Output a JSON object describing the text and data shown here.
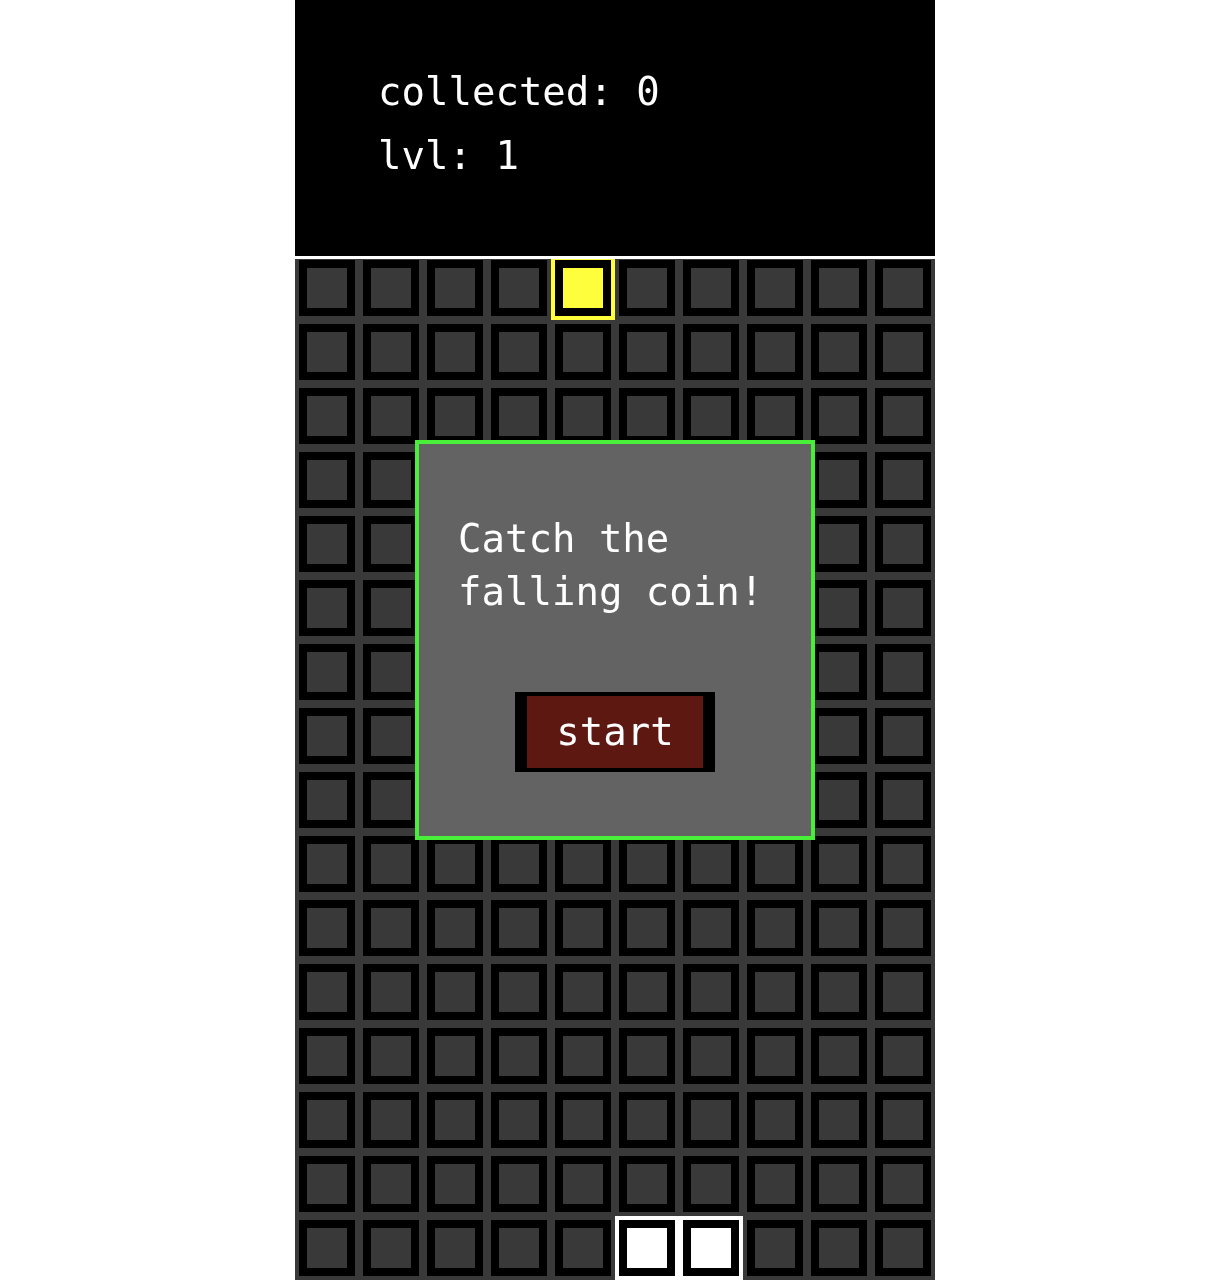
{
  "hud": [
    {
      "label": "collected: 0"
    },
    {
      "label": "lvl: 1"
    }
  ],
  "board": {
    "rows": [
      {
        "cells": [
          {
            "kind": "empty"
          },
          {
            "kind": "empty"
          },
          {
            "kind": "empty"
          },
          {
            "kind": "empty"
          },
          {
            "kind": "coin"
          },
          {
            "kind": "empty"
          },
          {
            "kind": "empty"
          },
          {
            "kind": "empty"
          },
          {
            "kind": "empty"
          },
          {
            "kind": "empty"
          }
        ]
      },
      {
        "cells": [
          {
            "kind": "empty"
          },
          {
            "kind": "empty"
          },
          {
            "kind": "empty"
          },
          {
            "kind": "empty"
          },
          {
            "kind": "empty"
          },
          {
            "kind": "empty"
          },
          {
            "kind": "empty"
          },
          {
            "kind": "empty"
          },
          {
            "kind": "empty"
          },
          {
            "kind": "empty"
          }
        ]
      },
      {
        "cells": [
          {
            "kind": "empty"
          },
          {
            "kind": "empty"
          },
          {
            "kind": "empty"
          },
          {
            "kind": "empty"
          },
          {
            "kind": "empty"
          },
          {
            "kind": "empty"
          },
          {
            "kind": "empty"
          },
          {
            "kind": "empty"
          },
          {
            "kind": "empty"
          },
          {
            "kind": "empty"
          }
        ]
      },
      {
        "cells": [
          {
            "kind": "empty"
          },
          {
            "kind": "empty"
          },
          {
            "kind": "covered"
          },
          {
            "kind": "covered"
          },
          {
            "kind": "covered"
          },
          {
            "kind": "covered"
          },
          {
            "kind": "covered"
          },
          {
            "kind": "covered"
          },
          {
            "kind": "empty"
          },
          {
            "kind": "empty"
          }
        ]
      },
      {
        "cells": [
          {
            "kind": "empty"
          },
          {
            "kind": "empty"
          },
          {
            "kind": "covered"
          },
          {
            "kind": "covered"
          },
          {
            "kind": "covered"
          },
          {
            "kind": "covered"
          },
          {
            "kind": "covered"
          },
          {
            "kind": "covered"
          },
          {
            "kind": "empty"
          },
          {
            "kind": "empty"
          }
        ]
      },
      {
        "cells": [
          {
            "kind": "empty"
          },
          {
            "kind": "empty"
          },
          {
            "kind": "covered"
          },
          {
            "kind": "covered"
          },
          {
            "kind": "covered"
          },
          {
            "kind": "covered"
          },
          {
            "kind": "covered"
          },
          {
            "kind": "covered"
          },
          {
            "kind": "empty"
          },
          {
            "kind": "empty"
          }
        ]
      },
      {
        "cells": [
          {
            "kind": "empty"
          },
          {
            "kind": "empty"
          },
          {
            "kind": "covered"
          },
          {
            "kind": "covered"
          },
          {
            "kind": "covered"
          },
          {
            "kind": "covered"
          },
          {
            "kind": "covered"
          },
          {
            "kind": "covered"
          },
          {
            "kind": "empty"
          },
          {
            "kind": "empty"
          }
        ]
      },
      {
        "cells": [
          {
            "kind": "empty"
          },
          {
            "kind": "empty"
          },
          {
            "kind": "covered"
          },
          {
            "kind": "covered"
          },
          {
            "kind": "covered"
          },
          {
            "kind": "covered"
          },
          {
            "kind": "covered"
          },
          {
            "kind": "covered"
          },
          {
            "kind": "empty"
          },
          {
            "kind": "empty"
          }
        ]
      },
      {
        "cells": [
          {
            "kind": "empty"
          },
          {
            "kind": "empty"
          },
          {
            "kind": "covered"
          },
          {
            "kind": "covered"
          },
          {
            "kind": "covered"
          },
          {
            "kind": "covered"
          },
          {
            "kind": "covered"
          },
          {
            "kind": "covered"
          },
          {
            "kind": "empty"
          },
          {
            "kind": "empty"
          }
        ]
      },
      {
        "cells": [
          {
            "kind": "empty"
          },
          {
            "kind": "empty"
          },
          {
            "kind": "empty"
          },
          {
            "kind": "empty"
          },
          {
            "kind": "empty"
          },
          {
            "kind": "empty"
          },
          {
            "kind": "empty"
          },
          {
            "kind": "empty"
          },
          {
            "kind": "empty"
          },
          {
            "kind": "empty"
          }
        ]
      },
      {
        "cells": [
          {
            "kind": "empty"
          },
          {
            "kind": "empty"
          },
          {
            "kind": "empty"
          },
          {
            "kind": "empty"
          },
          {
            "kind": "empty"
          },
          {
            "kind": "empty"
          },
          {
            "kind": "empty"
          },
          {
            "kind": "empty"
          },
          {
            "kind": "empty"
          },
          {
            "kind": "empty"
          }
        ]
      },
      {
        "cells": [
          {
            "kind": "empty"
          },
          {
            "kind": "empty"
          },
          {
            "kind": "empty"
          },
          {
            "kind": "empty"
          },
          {
            "kind": "empty"
          },
          {
            "kind": "empty"
          },
          {
            "kind": "empty"
          },
          {
            "kind": "empty"
          },
          {
            "kind": "empty"
          },
          {
            "kind": "empty"
          }
        ]
      },
      {
        "cells": [
          {
            "kind": "empty"
          },
          {
            "kind": "empty"
          },
          {
            "kind": "empty"
          },
          {
            "kind": "empty"
          },
          {
            "kind": "empty"
          },
          {
            "kind": "empty"
          },
          {
            "kind": "empty"
          },
          {
            "kind": "empty"
          },
          {
            "kind": "empty"
          },
          {
            "kind": "empty"
          }
        ]
      },
      {
        "cells": [
          {
            "kind": "empty"
          },
          {
            "kind": "empty"
          },
          {
            "kind": "empty"
          },
          {
            "kind": "empty"
          },
          {
            "kind": "empty"
          },
          {
            "kind": "empty"
          },
          {
            "kind": "empty"
          },
          {
            "kind": "empty"
          },
          {
            "kind": "empty"
          },
          {
            "kind": "empty"
          }
        ]
      },
      {
        "cells": [
          {
            "kind": "empty"
          },
          {
            "kind": "empty"
          },
          {
            "kind": "empty"
          },
          {
            "kind": "empty"
          },
          {
            "kind": "empty"
          },
          {
            "kind": "empty"
          },
          {
            "kind": "empty"
          },
          {
            "kind": "empty"
          },
          {
            "kind": "empty"
          },
          {
            "kind": "empty"
          }
        ]
      },
      {
        "cells": [
          {
            "kind": "empty"
          },
          {
            "kind": "empty"
          },
          {
            "kind": "empty"
          },
          {
            "kind": "empty"
          },
          {
            "kind": "empty"
          },
          {
            "kind": "player"
          },
          {
            "kind": "player"
          },
          {
            "kind": "empty"
          },
          {
            "kind": "empty"
          },
          {
            "kind": "empty"
          }
        ]
      }
    ]
  },
  "dialog": {
    "message": "Catch the falling coin!",
    "button": "start"
  }
}
